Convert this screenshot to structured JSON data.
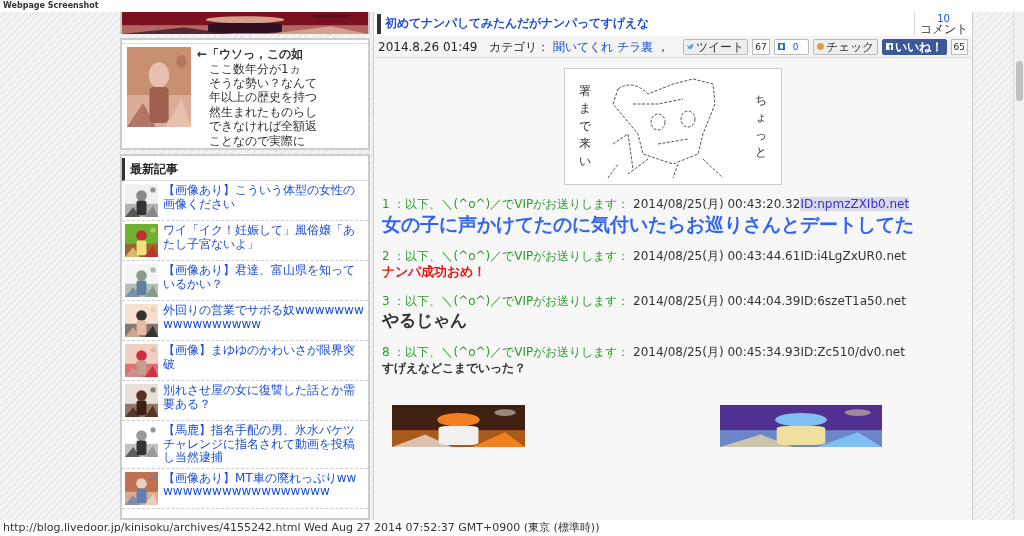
{
  "window": {
    "title": "Webpage Screenshot"
  },
  "sidebar": {
    "teaser": {
      "headline": "←「ウソっ，この如",
      "lines": [
        "ここ数年分が1ヵ",
        "そうな勢い？なんて",
        "年以上の歴史を持つ",
        "然生まれたものらし",
        "できなければ全額返",
        "ことなので実際に"
      ]
    },
    "recent": {
      "heading": "最新記事",
      "items": [
        {
          "title": "【画像あり】こういう体型の女性の画像ください"
        },
        {
          "title": "ワイ「イク！妊娠して」風俗嬢「あたし子宮ないよ」"
        },
        {
          "title": "【画像あり】君達、富山県を知っているかい？"
        },
        {
          "title": "外回りの営業でサボる奴wwwwwwwwwwwwwwwww"
        },
        {
          "title": "【画像】まゆゆのかわいさが限界突破"
        },
        {
          "title": "別れさせ屋の女に復讐した話とか需要ある？"
        },
        {
          "title": "【馬鹿】指名手配の男、氷水バケツチャレンジに指名されて動画を投稿し当然逮捕"
        },
        {
          "title": "【画像あり】MT車の廃れっぷりwwwwwwwwwwwwwwwwwww"
        }
      ]
    }
  },
  "article": {
    "title": "初めてナンパしてみたんだがナンパってすげえな",
    "comments": {
      "count": "10",
      "label": "コメント"
    },
    "date": "2014.8.26 01:49",
    "category_label": "カテゴリ：",
    "categories": [
      "聞いてくれ",
      "チラ裏"
    ],
    "category_end": "，",
    "share": [
      {
        "kind": "tweet",
        "label": "ツイート",
        "count": "67"
      },
      {
        "kind": "hatena",
        "count": "0"
      },
      {
        "kind": "check",
        "label": "チェック"
      },
      {
        "kind": "like",
        "label": "いいね！",
        "count": "65"
      }
    ],
    "art": {
      "left": "署まで来い",
      "right": "ちょっと"
    },
    "posts": [
      {
        "number": "1",
        "name": "：以下、＼(^o^)／でVIPがお送りします：",
        "date": "2014/08/25(月) 00:43:20.32",
        "id": "ID:npmzZXIb0.net",
        "id_highlighted": true,
        "kind": "blue-large",
        "text": "女の子に声かけてたのに気付いたらお巡りさんとデートしてた"
      },
      {
        "number": "2",
        "name": "：以下、＼(^o^)／でVIPがお送りします：",
        "date": "2014/08/25(月) 00:43:44.61",
        "id": "ID:i4LgZxUR0.net",
        "id_highlighted": false,
        "kind": "red-medium",
        "text": "ナンパ成功おめ！"
      },
      {
        "number": "3",
        "name": "：以下、＼(^o^)／でVIPがお送りします：",
        "date": "2014/08/25(月) 00:44:04.39",
        "id": "ID:6szeT1a50.net",
        "id_highlighted": false,
        "kind": "dark-large",
        "text": "やるじゃん"
      },
      {
        "number": "8",
        "name": "：以下、＼(^o^)／でVIPがお送りします：",
        "date": "2014/08/25(月) 00:45:34.93",
        "id": "ID:Zc510/dv0.net",
        "id_highlighted": false,
        "kind": "dark-medium",
        "text": "すげえなどこまでいった？"
      }
    ]
  },
  "status_bar": "http://blog.livedoor.jp/kinisoku/archives/4155242.html Wed Aug 27 2014 07:52:37 GMT+0900 (東京 (標準時))"
}
